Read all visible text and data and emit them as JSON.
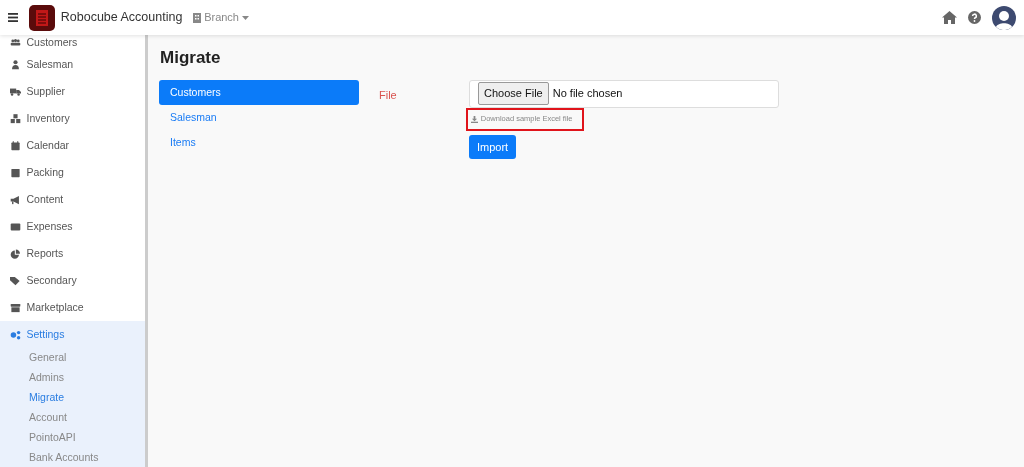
{
  "navbar": {
    "title": "Robocube Accounting",
    "branch": "Branch"
  },
  "sidebar": {
    "items": [
      {
        "label": "Customers",
        "selected": false
      },
      {
        "label": "Salesman",
        "selected": false
      },
      {
        "label": "Supplier",
        "selected": false
      },
      {
        "label": "Inventory",
        "selected": false
      },
      {
        "label": "Calendar",
        "selected": false
      },
      {
        "label": "Packing",
        "selected": false
      },
      {
        "label": "Content",
        "selected": false
      },
      {
        "label": "Expenses",
        "selected": false
      },
      {
        "label": "Reports",
        "selected": false
      },
      {
        "label": "Secondary",
        "selected": false
      },
      {
        "label": "Marketplace",
        "selected": false
      },
      {
        "label": "Settings",
        "selected": true,
        "expanded": true,
        "children": [
          {
            "label": "General",
            "selected": false
          },
          {
            "label": "Admins",
            "selected": false
          },
          {
            "label": "Migrate",
            "selected": true
          },
          {
            "label": "Account",
            "selected": false
          },
          {
            "label": "PointoAPI",
            "selected": false
          },
          {
            "label": "Bank Accounts",
            "selected": false
          }
        ]
      }
    ]
  },
  "page": {
    "title": "Migrate",
    "tabs": [
      {
        "label": "Customers",
        "selected": true
      },
      {
        "label": "Salesman",
        "selected": false
      },
      {
        "label": "Items",
        "selected": false
      }
    ],
    "form": {
      "label": "File",
      "choose_button": "Choose File",
      "file_status": "No file chosen",
      "download_link": "Download sample Excel file",
      "submit": "Import"
    }
  }
}
